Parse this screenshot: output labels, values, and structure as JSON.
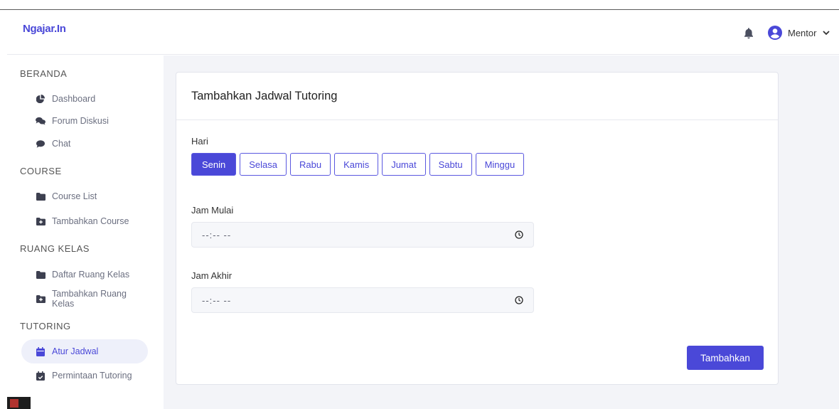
{
  "app": {
    "brand": "Ngajar.In"
  },
  "header": {
    "notification_icon": "bell-icon",
    "user": {
      "avatar_icon": "user-circle-icon",
      "name": "Mentor",
      "dropdown_icon": "chevron-down-icon"
    }
  },
  "sidebar": {
    "sections": [
      {
        "title": "BERANDA",
        "items": [
          {
            "label": "Dashboard",
            "icon": "chart-pie-icon"
          },
          {
            "label": "Forum Diskusi",
            "icon": "comments-icon"
          },
          {
            "label": "Chat",
            "icon": "chat-bubble-icon"
          }
        ]
      },
      {
        "title": "COURSE",
        "items": [
          {
            "label": "Course List",
            "icon": "folder-icon"
          },
          {
            "label": "Tambahkan Course",
            "icon": "folder-plus-icon"
          }
        ]
      },
      {
        "title": "RUANG KELAS",
        "items": [
          {
            "label": "Daftar Ruang Kelas",
            "icon": "folder-icon"
          },
          {
            "label": "Tambahkan Ruang Kelas",
            "icon": "folder-plus-icon"
          }
        ]
      },
      {
        "title": "TUTORING",
        "items": [
          {
            "label": "Atur Jadwal",
            "icon": "calendar-icon",
            "active": true
          },
          {
            "label": "Permintaan Tutoring",
            "icon": "calendar-check-icon"
          }
        ]
      }
    ]
  },
  "form": {
    "title": "Tambahkan Jadwal Tutoring",
    "day_label": "Hari",
    "days": [
      "Senin",
      "Selasa",
      "Rabu",
      "Kamis",
      "Jumat",
      "Sabtu",
      "Minggu"
    ],
    "selected_day": "Senin",
    "start_label": "Jam Mulai",
    "start_value": "--:-- --",
    "end_label": "Jam Akhir",
    "end_value": "--:-- --",
    "submit_label": "Tambahkan"
  },
  "colors": {
    "accent": "#4a48d8",
    "active_nav_bg": "#eef0fa",
    "main_bg": "#f3f4f8"
  }
}
